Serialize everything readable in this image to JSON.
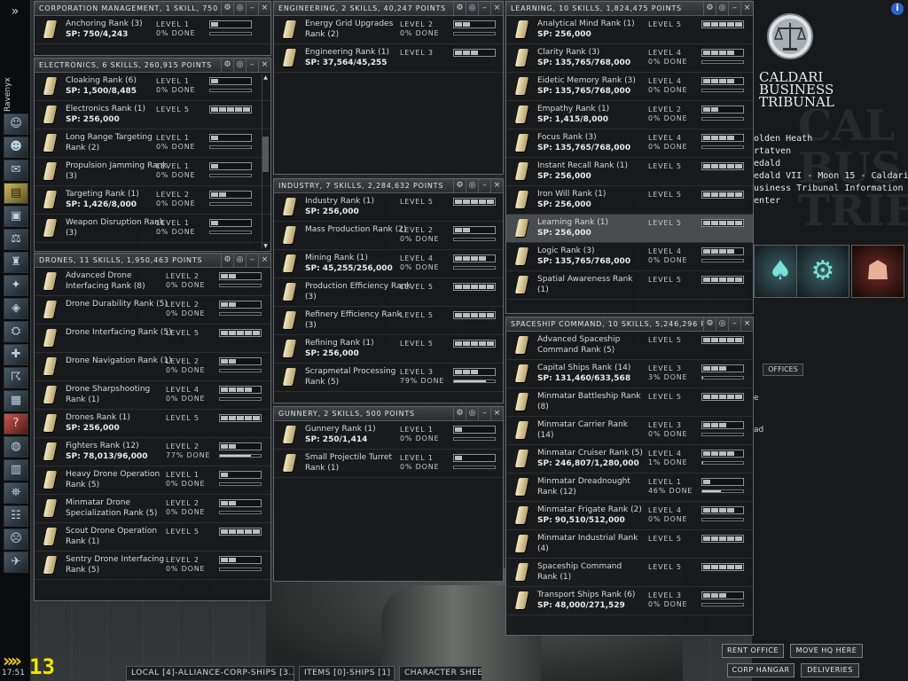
{
  "character_name": "Ravenyx",
  "clock": "17:51",
  "counter": "13",
  "bottom_tabs": [
    "LOCAL [4]-ALLIANCE-CORP-SHIPS [3...",
    "ITEMS [0]-SHIPS [1]",
    "CHARACTER SHEET"
  ],
  "station": {
    "corp_name_1": "CALDARI",
    "corp_name_2": "BUSINESS",
    "corp_name_3": "TRIBUNAL",
    "corp_bg_1": "CAL",
    "corp_bg_2": "BUS",
    "corp_bg_3": "TRIB",
    "info": [
      "olden Heath",
      "rtatven",
      "edald",
      "edald VII - Moon 15 - Caldari",
      "usiness Tribunal Information",
      "enter"
    ],
    "offices_tab": "OFFICES",
    "rent_office": "RENT OFFICE",
    "move_hq": "MOVE HQ HERE",
    "corp_hangar": "CORP HANGAR",
    "deliveries": "DELIVERIES",
    "clipped_1": "e",
    "clipped_2": "ad"
  },
  "window_buttons": {
    "pin": "⚙",
    "opts": "◎",
    "min": "–",
    "close": "×"
  },
  "corp": {
    "title": "CORPORATION MANAGEMENT, 1 SKILL, 750 POINTS",
    "skills": [
      {
        "name": "Anchoring Rank (3)",
        "sp": "SP: 750/4,243",
        "level": "LEVEL 1",
        "pct": "0% DONE",
        "lv": 1,
        "progress": 0
      }
    ]
  },
  "elec": {
    "title": "ELECTRONICS, 6 SKILLS, 260,915 POINTS",
    "skills": [
      {
        "name": "Cloaking Rank (6)",
        "sp": "SP: 1,500/8,485",
        "level": "LEVEL 1",
        "pct": "0% DONE",
        "lv": 1,
        "progress": 0
      },
      {
        "name": "Electronics Rank (1)",
        "sp": "SP: 256,000",
        "level": "LEVEL 5",
        "pct": "",
        "lv": 5,
        "progress": -1
      },
      {
        "name": "Long Range Targeting Rank (2)",
        "sp": "",
        "level": "LEVEL 1",
        "pct": "0% DONE",
        "lv": 1,
        "progress": 0
      },
      {
        "name": "Propulsion Jamming Rank (3)",
        "sp": "",
        "level": "LEVEL 1",
        "pct": "0% DONE",
        "lv": 1,
        "progress": 0
      },
      {
        "name": "Targeting Rank (1)",
        "sp": "SP: 1,426/8,000",
        "level": "LEVEL 2",
        "pct": "0% DONE",
        "lv": 2,
        "progress": 0
      },
      {
        "name": "Weapon Disruption Rank (3)",
        "sp": "",
        "level": "LEVEL 1",
        "pct": "0% DONE",
        "lv": 1,
        "progress": 0
      }
    ]
  },
  "drones": {
    "title": "DRONES, 11 SKILLS, 1,950,463 POINTS",
    "skills": [
      {
        "name": "Advanced Drone Interfacing Rank (8)",
        "sp": "",
        "level": "LEVEL 2",
        "pct": "0% DONE",
        "lv": 2,
        "progress": 0
      },
      {
        "name": "Drone Durability Rank (5)",
        "sp": "",
        "level": "LEVEL 2",
        "pct": "0% DONE",
        "lv": 2,
        "progress": 0
      },
      {
        "name": "Drone Interfacing Rank (5)",
        "sp": "",
        "level": "LEVEL 5",
        "pct": "",
        "lv": 5,
        "progress": -1
      },
      {
        "name": "Drone Navigation Rank (1)",
        "sp": "",
        "level": "LEVEL 2",
        "pct": "0% DONE",
        "lv": 2,
        "progress": 0
      },
      {
        "name": "Drone Sharpshooting Rank (1)",
        "sp": "",
        "level": "LEVEL 4",
        "pct": "0% DONE",
        "lv": 4,
        "progress": 0
      },
      {
        "name": "Drones Rank (1)",
        "sp": "SP: 256,000",
        "level": "LEVEL 5",
        "pct": "",
        "lv": 5,
        "progress": -1
      },
      {
        "name": "Fighters Rank (12)",
        "sp": "SP: 78,013/96,000",
        "level": "LEVEL 2",
        "pct": "77% DONE",
        "lv": 2,
        "progress": 77
      },
      {
        "name": "Heavy Drone Operation Rank (5)",
        "sp": "",
        "level": "LEVEL 1",
        "pct": "0% DONE",
        "lv": 1,
        "progress": 0
      },
      {
        "name": "Minmatar Drone Specialization Rank (5)",
        "sp": "",
        "level": "LEVEL 2",
        "pct": "0% DONE",
        "lv": 2,
        "progress": 0
      },
      {
        "name": "Scout Drone Operation Rank (1)",
        "sp": "",
        "level": "LEVEL 5",
        "pct": "",
        "lv": 5,
        "progress": -1
      },
      {
        "name": "Sentry Drone Interfacing Rank (5)",
        "sp": "",
        "level": "LEVEL 2",
        "pct": "0% DONE",
        "lv": 2,
        "progress": 0
      }
    ]
  },
  "eng": {
    "title": "ENGINEERING, 2 SKILLS, 40,247 POINTS",
    "skills": [
      {
        "name": "Energy Grid Upgrades Rank (2)",
        "sp": "",
        "level": "LEVEL 2",
        "pct": "0% DONE",
        "lv": 2,
        "progress": 0
      },
      {
        "name": "Engineering Rank (1)",
        "sp": "SP: 37,564/45,255",
        "level": "LEVEL 3",
        "pct": "",
        "lv": 3,
        "progress": -1
      }
    ]
  },
  "ind": {
    "title": "INDUSTRY, 7 SKILLS, 2,284,632 POINTS",
    "skills": [
      {
        "name": "Industry Rank (1)",
        "sp": "SP: 256,000",
        "level": "LEVEL 5",
        "pct": "",
        "lv": 5,
        "progress": -1
      },
      {
        "name": "Mass Production Rank (2)",
        "sp": "",
        "level": "LEVEL 2",
        "pct": "0% DONE",
        "lv": 2,
        "progress": 0
      },
      {
        "name": "Mining Rank (1)",
        "sp": "SP: 45,255/256,000",
        "level": "LEVEL 4",
        "pct": "0% DONE",
        "lv": 4,
        "progress": 0
      },
      {
        "name": "Production Efficiency Rank (3)",
        "sp": "",
        "level": "LEVEL 5",
        "pct": "",
        "lv": 5,
        "progress": -1
      },
      {
        "name": "Refinery Efficiency Rank (3)",
        "sp": "",
        "level": "LEVEL 5",
        "pct": "",
        "lv": 5,
        "progress": -1
      },
      {
        "name": "Refining Rank (1)",
        "sp": "SP: 256,000",
        "level": "LEVEL 5",
        "pct": "",
        "lv": 5,
        "progress": -1
      },
      {
        "name": "Scrapmetal Processing Rank (5)",
        "sp": "",
        "level": "LEVEL 3",
        "pct": "79% DONE",
        "lv": 3,
        "progress": 79
      }
    ]
  },
  "gun": {
    "title": "GUNNERY, 2 SKILLS, 500 POINTS",
    "skills": [
      {
        "name": "Gunnery Rank (1)",
        "sp": "SP: 250/1,414",
        "level": "LEVEL 1",
        "pct": "0% DONE",
        "lv": 1,
        "progress": 0
      },
      {
        "name": "Small Projectile Turret Rank (1)",
        "sp": "",
        "level": "LEVEL 1",
        "pct": "0% DONE",
        "lv": 1,
        "progress": 0
      }
    ]
  },
  "learn": {
    "title": "LEARNING, 10 SKILLS, 1,824,475 POINTS",
    "skills": [
      {
        "name": "Analytical Mind Rank (1)",
        "sp": "SP: 256,000",
        "level": "LEVEL 5",
        "pct": "",
        "lv": 5,
        "progress": -1
      },
      {
        "name": "Clarity Rank (3)",
        "sp": "SP: 135,765/768,000",
        "level": "LEVEL 4",
        "pct": "0% DONE",
        "lv": 4,
        "progress": 0
      },
      {
        "name": "Eidetic Memory Rank (3)",
        "sp": "SP: 135,765/768,000",
        "level": "LEVEL 4",
        "pct": "0% DONE",
        "lv": 4,
        "progress": 0
      },
      {
        "name": "Empathy Rank (1)",
        "sp": "SP: 1,415/8,000",
        "level": "LEVEL 2",
        "pct": "0% DONE",
        "lv": 2,
        "progress": 0
      },
      {
        "name": "Focus Rank (3)",
        "sp": "SP: 135,765/768,000",
        "level": "LEVEL 4",
        "pct": "0% DONE",
        "lv": 4,
        "progress": 0
      },
      {
        "name": "Instant Recall Rank (1)",
        "sp": "SP: 256,000",
        "level": "LEVEL 5",
        "pct": "",
        "lv": 5,
        "progress": -1
      },
      {
        "name": "Iron Will Rank (1)",
        "sp": "SP: 256,000",
        "level": "LEVEL 5",
        "pct": "",
        "lv": 5,
        "progress": -1
      },
      {
        "name": "Learning Rank (1)",
        "sp": "SP: 256,000",
        "level": "LEVEL 5",
        "pct": "",
        "lv": 5,
        "progress": -1,
        "selected": true
      },
      {
        "name": "Logic Rank (3)",
        "sp": "SP: 135,765/768,000",
        "level": "LEVEL 4",
        "pct": "0% DONE",
        "lv": 4,
        "progress": 0
      },
      {
        "name": "Spatial Awareness Rank (1)",
        "sp": "",
        "level": "LEVEL 5",
        "pct": "",
        "lv": 5,
        "progress": -1
      }
    ]
  },
  "ship": {
    "title": "SPACESHIP COMMAND, 10 SKILLS, 5,246,296 POINTS",
    "skills": [
      {
        "name": "Advanced Spaceship Command Rank (5)",
        "sp": "",
        "level": "LEVEL 5",
        "pct": "",
        "lv": 5,
        "progress": -1
      },
      {
        "name": "Capital Ships Rank (14)",
        "sp": "SP: 131,460/633,568",
        "level": "LEVEL 3",
        "pct": "3% DONE",
        "lv": 3,
        "progress": 3
      },
      {
        "name": "Minmatar Battleship Rank (8)",
        "sp": "",
        "level": "LEVEL 5",
        "pct": "",
        "lv": 5,
        "progress": -1
      },
      {
        "name": "Minmatar Carrier Rank (14)",
        "sp": "",
        "level": "LEVEL 3",
        "pct": "0% DONE",
        "lv": 3,
        "progress": 0
      },
      {
        "name": "Minmatar Cruiser Rank (5)",
        "sp": "SP: 246,807/1,280,000",
        "level": "LEVEL 4",
        "pct": "1% DONE",
        "lv": 4,
        "progress": 1
      },
      {
        "name": "Minmatar Dreadnought Rank (12)",
        "sp": "",
        "level": "LEVEL 1",
        "pct": "46% DONE",
        "lv": 1,
        "progress": 46
      },
      {
        "name": "Minmatar Frigate Rank (2)",
        "sp": "SP: 90,510/512,000",
        "level": "LEVEL 4",
        "pct": "0% DONE",
        "lv": 4,
        "progress": 0
      },
      {
        "name": "Minmatar Industrial Rank (4)",
        "sp": "",
        "level": "LEVEL 5",
        "pct": "",
        "lv": 5,
        "progress": -1
      },
      {
        "name": "Spaceship Command Rank (1)",
        "sp": "",
        "level": "LEVEL 5",
        "pct": "",
        "lv": 5,
        "progress": -1
      },
      {
        "name": "Transport Ships Rank (6)",
        "sp": "SP: 48,000/271,529",
        "level": "LEVEL 3",
        "pct": "0% DONE",
        "lv": 3,
        "progress": 0
      }
    ]
  },
  "icons": {
    "neocom": [
      "character-sheet-icon",
      "people-places-icon",
      "mail-icon",
      "notepad-icon",
      "assets-icon",
      "wallet-icon",
      "corporation-icon",
      "map-icon",
      "market-icon",
      "industry-icon",
      "science-icon",
      "contracts-icon",
      "calculator-icon",
      "help-icon",
      "browser-icon",
      "journal-icon",
      "fitting-icon",
      "news-icon",
      "portrait-icon",
      "ship-icon"
    ]
  }
}
